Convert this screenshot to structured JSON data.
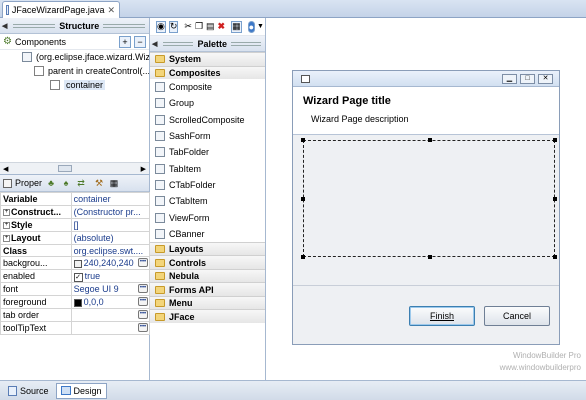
{
  "editor": {
    "tab_title": "JFaceWizardPage.java",
    "close_glyph": "✕"
  },
  "structure": {
    "title": "Structure",
    "components_label": "Components",
    "tree": [
      "(org.eclipse.jface.wizard.Wiz",
      "parent in createControl(...",
      "container"
    ]
  },
  "properties": {
    "title": "Proper",
    "rows": [
      {
        "name": "Variable",
        "value": "container",
        "bold": true
      },
      {
        "name": "Construct...",
        "value": "(Constructor pr...",
        "bold": true,
        "expand": true
      },
      {
        "name": "Style",
        "value": "[]",
        "bold": true,
        "expand": true
      },
      {
        "name": "Layout",
        "value": "(absolute)",
        "bold": true,
        "expand": true
      },
      {
        "name": "Class",
        "value": "org.eclipse.swt....",
        "bold": true
      },
      {
        "name": "backgrou...",
        "value": "240,240,240",
        "swatch": "#f0f0f0",
        "ellipsis": true
      },
      {
        "name": "enabled",
        "value": "true",
        "check": true
      },
      {
        "name": "font",
        "value": "Segoe UI 9",
        "ellipsis": true
      },
      {
        "name": "foreground",
        "value": "0,0,0",
        "swatch": "#000000",
        "ellipsis": true
      },
      {
        "name": "tab order",
        "value": "",
        "ellipsis": true
      },
      {
        "name": "toolTipText",
        "value": "",
        "ellipsis": true
      }
    ]
  },
  "palette": {
    "title": "Palette",
    "categories_top": [
      "System",
      "Composites"
    ],
    "items": [
      "Composite",
      "Group",
      "ScrolledComposite",
      "SashForm",
      "TabFolder",
      "TabItem",
      "CTabFolder",
      "CTabItem",
      "ViewForm",
      "CBanner"
    ],
    "categories_bottom": [
      "Layouts",
      "Controls",
      "Nebula",
      "Forms API",
      "Menu",
      "JFace"
    ]
  },
  "dialog": {
    "title": "Wizard Page title",
    "description": "Wizard Page description",
    "finish_label": "Finish",
    "cancel_label": "Cancel"
  },
  "watermark": {
    "line1": "WindowBuilder Pro",
    "line2": "www.windowbuilderpro"
  },
  "bottom_tabs": {
    "source": "Source",
    "design": "Design",
    "active": "Design"
  },
  "colors": {
    "accent": "#1b3c8c",
    "folder": "#f3d57a"
  }
}
